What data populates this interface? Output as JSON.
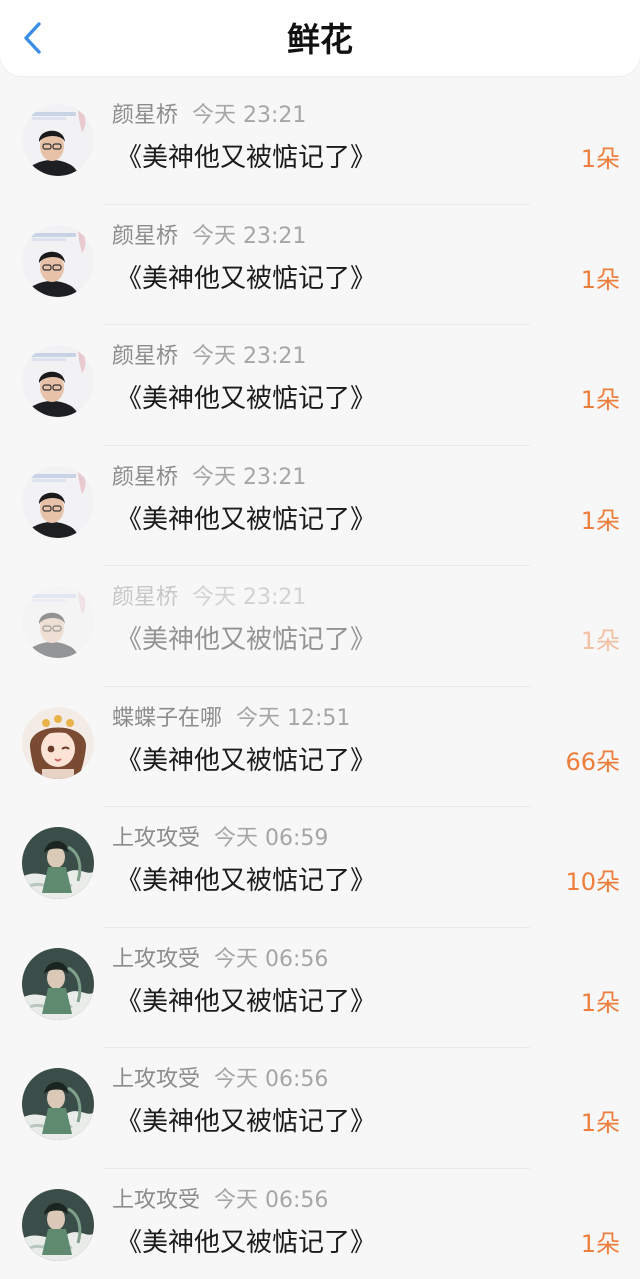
{
  "header": {
    "title": "鲜花",
    "back_icon": "chevron-left-icon",
    "accent_color": "#3a8ee6"
  },
  "colors": {
    "count": "#ef7e3d"
  },
  "items": [
    {
      "user": "颜星桥",
      "time": "今天 23:21",
      "book": "《美神他又被惦记了》",
      "count": "1朵",
      "avatar": "photo-avatar-icon"
    },
    {
      "user": "颜星桥",
      "time": "今天 23:21",
      "book": "《美神他又被惦记了》",
      "count": "1朵",
      "avatar": "photo-avatar-icon"
    },
    {
      "user": "颜星桥",
      "time": "今天 23:21",
      "book": "《美神他又被惦记了》",
      "count": "1朵",
      "avatar": "photo-avatar-icon"
    },
    {
      "user": "颜星桥",
      "time": "今天 23:21",
      "book": "《美神他又被惦记了》",
      "count": "1朵",
      "avatar": "photo-avatar-icon"
    },
    {
      "user": "颜星桥",
      "time": "今天 23:21",
      "book": "《美神他又被惦记了》",
      "count": "1朵",
      "avatar": "photo-avatar-icon"
    },
    {
      "user": "蝶蝶子在哪",
      "time": "今天 12:51",
      "book": "《美神他又被惦记了》",
      "count": "66朵",
      "avatar": "anime-girl-avatar-icon"
    },
    {
      "user": "上攻攻受",
      "time": "今天 06:59",
      "book": "《美神他又被惦记了》",
      "count": "10朵",
      "avatar": "illustration-avatar-icon"
    },
    {
      "user": "上攻攻受",
      "time": "今天 06:56",
      "book": "《美神他又被惦记了》",
      "count": "1朵",
      "avatar": "illustration-avatar-icon"
    },
    {
      "user": "上攻攻受",
      "time": "今天 06:56",
      "book": "《美神他又被惦记了》",
      "count": "1朵",
      "avatar": "illustration-avatar-icon"
    },
    {
      "user": "上攻攻受",
      "time": "今天 06:56",
      "book": "《美神他又被惦记了》",
      "count": "1朵",
      "avatar": "illustration-avatar-icon"
    }
  ]
}
